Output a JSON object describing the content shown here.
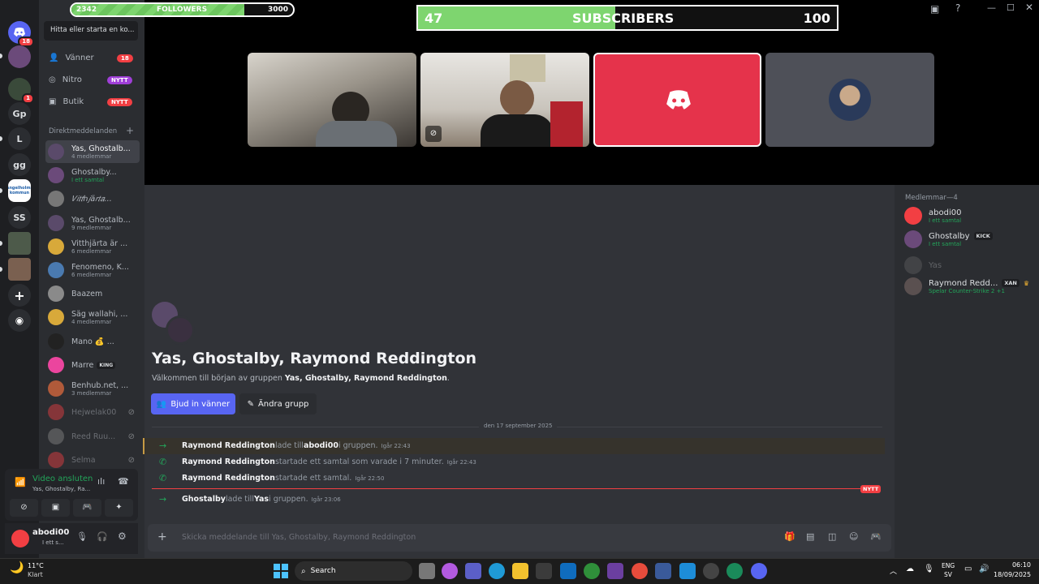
{
  "overlays": {
    "followers": {
      "current": "2342",
      "label": "FOLLOWERS",
      "goal": "3000",
      "progress": 0.78
    },
    "subscribers": {
      "current": "47",
      "label": "SUBSCRIBERS",
      "goal": "100",
      "progress": 0.47
    }
  },
  "rail": {
    "dm_badge": "18",
    "avatar_badge": "1",
    "servers": [
      "Gp",
      "L",
      "gg",
      "Ängelholms kommun",
      "SS"
    ]
  },
  "sidebar": {
    "search_placeholder": "Hitta eller starta en ko...",
    "nav": [
      {
        "label": "Vänner",
        "badge": "18"
      },
      {
        "label": "Nitro",
        "badge": "NYTT"
      },
      {
        "label": "Butik",
        "badge": "NYTT"
      }
    ],
    "dm_header": "Direktmeddelanden",
    "dms": [
      {
        "name": "Yas, Ghostalb...",
        "sub": "4 medlemmar"
      },
      {
        "name": "Ghostalby...",
        "sub": "I ett samtal"
      },
      {
        "name": "𝑉𝑖𝑡𝑡ℎ𝑗ä𝑟𝑡𝑎...",
        "sub": ""
      },
      {
        "name": "Yas, Ghostalb...",
        "sub": "9 medlemmar"
      },
      {
        "name": "Vitthjärta är ...",
        "sub": "6 medlemmar"
      },
      {
        "name": "Fenomeno, K...",
        "sub": "6 medlemmar"
      },
      {
        "name": "Baazem",
        "sub": ""
      },
      {
        "name": "Säg wallahi, ...",
        "sub": "4 medlemmar"
      },
      {
        "name": "Mano 💰 ...",
        "sub": ""
      },
      {
        "name": "Marre",
        "sub": "",
        "tag": "KING"
      },
      {
        "name": "Benhub.net, ...",
        "sub": "3 medlemmar"
      },
      {
        "name": "Hejwelak00",
        "sub": ""
      },
      {
        "name": "Reed Ruu...",
        "sub": ""
      },
      {
        "name": "Selma",
        "sub": ""
      }
    ]
  },
  "voice": {
    "status": "Video ansluten",
    "channel": "Yas, Ghostalby, Ra..."
  },
  "user": {
    "name": "abodi00",
    "status": "I ett s..."
  },
  "main": {
    "title": "Yas, Ghostalby, Raymond Reddington",
    "welcome_prefix": "Välkommen till början av gruppen ",
    "welcome_group": "Yas, Ghostalby, Raymond Reddington",
    "welcome_suffix": ".",
    "invite_button": "Bjud in vänner",
    "edit_button": "Ändra grupp",
    "date_divider": "den 17 september 2025",
    "new_tag": "NYTT",
    "messages": [
      {
        "actor": "Raymond Reddington",
        "text1": " lade till ",
        "target": "abodi00",
        "text2": " i gruppen.",
        "time": "Igår 22:43"
      },
      {
        "actor": "Raymond Reddington",
        "text1": " startade ett samtal som varade i 7 minuter.",
        "target": "",
        "text2": "",
        "time": "Igår 22:43"
      },
      {
        "actor": "Raymond Reddington",
        "text1": " startade ett samtal.",
        "target": "",
        "text2": "",
        "time": "Igår 22:50"
      },
      {
        "actor": "Ghostalby",
        "text1": " lade till ",
        "target": "Yas",
        "text2": " i gruppen.",
        "time": "Igår 23:06"
      }
    ],
    "composer_placeholder": "Skicka meddelande till Yas, Ghostalby, Raymond Reddington"
  },
  "members": {
    "header": "Medlemmar—4",
    "list": [
      {
        "name": "abodi00",
        "sub": "I ett samtal",
        "tag": ""
      },
      {
        "name": "Ghostalby",
        "sub": "I ett samtal",
        "tag": "KICK"
      },
      {
        "name": "Yas",
        "sub": "",
        "tag": ""
      },
      {
        "name": "Raymond Redd...",
        "sub": "Spelar Counter-Strike 2 +1",
        "tag": "XAN"
      }
    ]
  },
  "taskbar": {
    "weather_temp": "11°C",
    "weather_desc": "Klart",
    "search": "Search",
    "lang": "ENG",
    "region": "SV",
    "time": "06:10",
    "date": "18/09/2025"
  },
  "colors": {
    "accent": "#5865f2",
    "green": "#23a55a",
    "red": "#f23f43",
    "bar_green": "#7ed56f",
    "tile_red": "#e5334b"
  }
}
